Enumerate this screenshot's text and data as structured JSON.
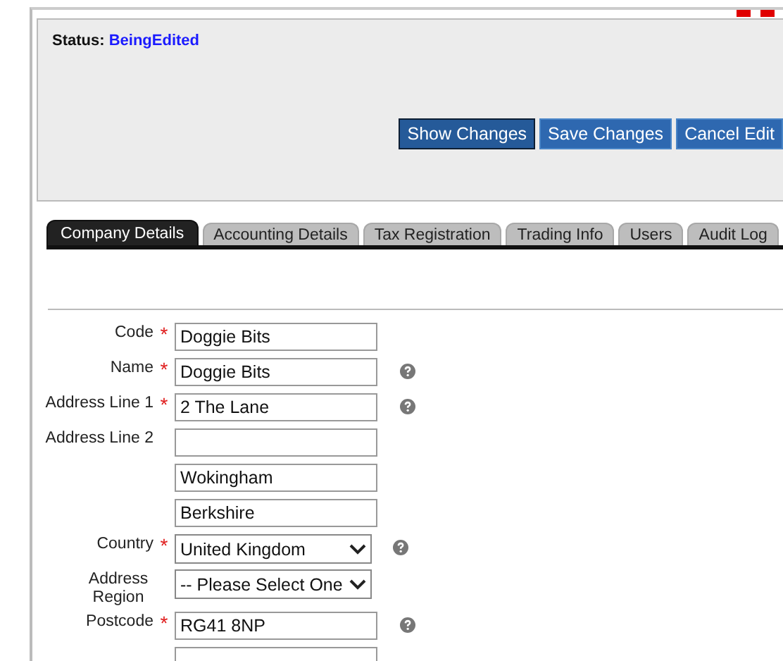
{
  "status": {
    "label": "Status:",
    "value": "BeingEdited"
  },
  "buttons": [
    {
      "label": "Show Changes",
      "selected": true
    },
    {
      "label": "Save Changes",
      "selected": false
    },
    {
      "label": "Cancel Edit",
      "selected": false
    }
  ],
  "tabs": [
    {
      "label": "Company Details",
      "selected": true
    },
    {
      "label": "Accounting Details",
      "selected": false
    },
    {
      "label": "Tax Registration",
      "selected": false
    },
    {
      "label": "Trading Info",
      "selected": false
    },
    {
      "label": "Users",
      "selected": false
    },
    {
      "label": "Audit Log",
      "selected": false
    }
  ],
  "fields": [
    {
      "label": "Code",
      "required_mark": "*",
      "kind": "text",
      "value": "Doggie Bits",
      "help": false
    },
    {
      "label": "Name",
      "required_mark": "*",
      "kind": "text",
      "value": "Doggie Bits",
      "help": true
    },
    {
      "label": "Address Line 1",
      "required_mark": "*",
      "kind": "text",
      "value": "2 The Lane",
      "help": true
    },
    {
      "label": "Address Line 2",
      "kind": "text",
      "help": false
    },
    {
      "kind": "text",
      "value": "Wokingham",
      "help": false
    },
    {
      "kind": "text",
      "value": "Berkshire",
      "help": false
    },
    {
      "label": "Country",
      "required_mark": "*",
      "kind": "select",
      "value": "United Kingdom",
      "help": true
    },
    {
      "label": "Address Region",
      "kind": "select",
      "value": "-- Please Select One",
      "help": false
    },
    {
      "label": "Postcode",
      "required_mark": "*",
      "kind": "text",
      "value": "RG41 8NP",
      "help": true
    },
    {
      "kind": "text",
      "help": false
    }
  ]
}
